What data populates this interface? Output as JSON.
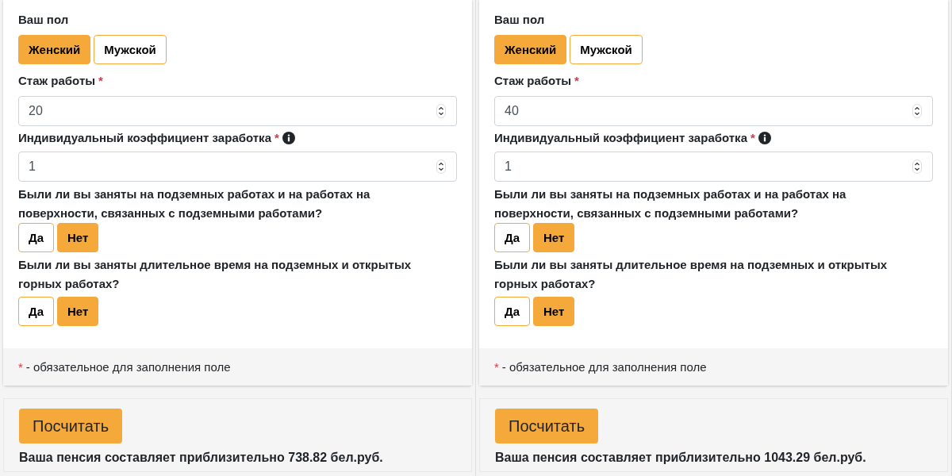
{
  "panels": [
    {
      "gender": {
        "label": "Ваш пол",
        "options": [
          {
            "label": "Женский",
            "selected": true
          },
          {
            "label": "Мужской",
            "selected": false
          }
        ]
      },
      "fields": [
        {
          "label": "Стаж работы",
          "required": true,
          "info": false,
          "value": "20"
        },
        {
          "label": "Индивидуальный коэффициент заработка",
          "required": true,
          "info": true,
          "value": "1"
        }
      ],
      "questions": [
        {
          "text": "Были ли вы заняты на подземных работах и на работах на поверхности, связанных с подземными работами?",
          "options": [
            {
              "label": "Да",
              "selected": false
            },
            {
              "label": "Нет",
              "selected": true
            }
          ]
        },
        {
          "text": "Были ли вы заняты длительное время на подземных и открытых горных работах?",
          "options": [
            {
              "label": "Да",
              "selected": false
            },
            {
              "label": "Нет",
              "selected": true
            }
          ]
        }
      ],
      "footnote": {
        "mark": "*",
        "text": "- обязательное для заполнения поле"
      },
      "button": "Посчитать",
      "result": "Ваша пенсия составляет приблизительно 738.82 бел.руб."
    },
    {
      "gender": {
        "label": "Ваш пол",
        "options": [
          {
            "label": "Женский",
            "selected": true
          },
          {
            "label": "Мужской",
            "selected": false
          }
        ]
      },
      "fields": [
        {
          "label": "Стаж работы",
          "required": true,
          "info": false,
          "value": "40"
        },
        {
          "label": "Индивидуальный коэффициент заработка",
          "required": true,
          "info": true,
          "value": "1"
        }
      ],
      "questions": [
        {
          "text": "Были ли вы заняты на подземных работах и на работах на поверхности, связанных с подземными работами?",
          "options": [
            {
              "label": "Да",
              "selected": false
            },
            {
              "label": "Нет",
              "selected": true
            }
          ]
        },
        {
          "text": "Были ли вы заняты длительное время на подземных и открытых горных работах?",
          "options": [
            {
              "label": "Да",
              "selected": false
            },
            {
              "label": "Нет",
              "selected": true
            }
          ]
        }
      ],
      "footnote": {
        "mark": "*",
        "text": "- обязательное для заполнения поле"
      },
      "button": "Посчитать",
      "result": "Ваша пенсия составляет приблизительно 1043.29 бел.руб."
    }
  ]
}
